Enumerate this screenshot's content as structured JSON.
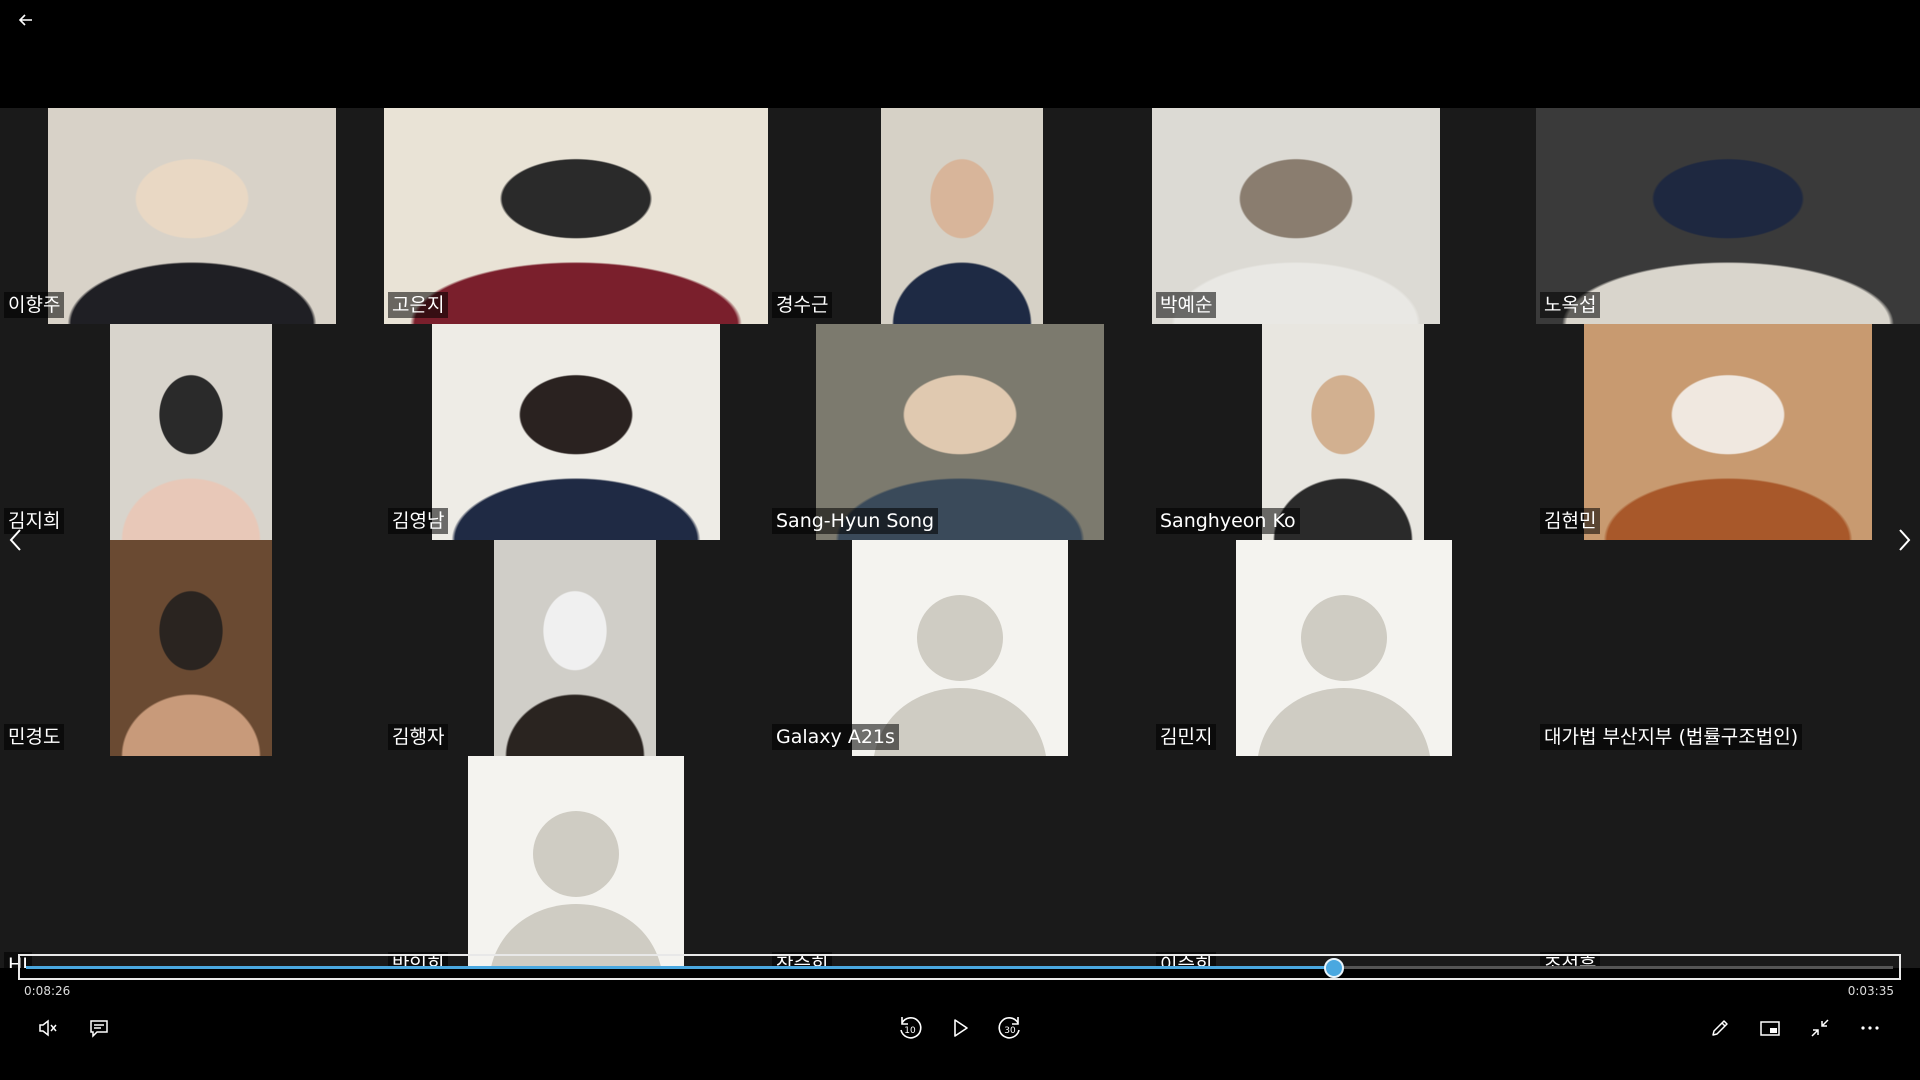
{
  "window": {
    "back_label": "Back"
  },
  "participants": [
    {
      "name": "이향주",
      "kind": "video",
      "colors": [
        "#d8d2c8",
        "#1f1f24",
        "#e9d8c4"
      ]
    },
    {
      "name": "고은지",
      "kind": "video",
      "colors": [
        "#e9e3d6",
        "#7a1f2c",
        "#2a2a2a"
      ]
    },
    {
      "name": "경수근",
      "kind": "video",
      "colors": [
        "#d6d1c6",
        "#1e2a44",
        "#d8b59a"
      ]
    },
    {
      "name": "박예순",
      "kind": "video",
      "colors": [
        "#dcdad4",
        "#e9e8e4",
        "#8a7d6f"
      ]
    },
    {
      "name": "노옥섭",
      "kind": "video",
      "colors": [
        "#3a3a3a",
        "#d9d5cc",
        "#1e2840"
      ]
    },
    {
      "name": "김지희",
      "kind": "video",
      "colors": [
        "#d8d4cc",
        "#e8c8b8",
        "#2a2a2a"
      ]
    },
    {
      "name": "김영남",
      "kind": "video",
      "colors": [
        "#eeece6",
        "#1f2a44",
        "#2a2220"
      ]
    },
    {
      "name": "Sang-Hyun Song",
      "kind": "video",
      "colors": [
        "#7c7a6e",
        "#3a4a5a",
        "#e0c9b0"
      ]
    },
    {
      "name": "Sanghyeon Ko",
      "kind": "video",
      "colors": [
        "#e8e6e0",
        "#2a2a2a",
        "#d2b090"
      ]
    },
    {
      "name": "김현민",
      "kind": "video",
      "colors": [
        "#c89a70",
        "#a8582a",
        "#f0e8e0"
      ]
    },
    {
      "name": "민경도",
      "kind": "video",
      "colors": [
        "#6a4a32",
        "#c89a7a",
        "#2a2420"
      ]
    },
    {
      "name": "김행자",
      "kind": "video",
      "colors": [
        "#d0cec8",
        "#2a2420",
        "#f0f0f0"
      ]
    },
    {
      "name": "Galaxy A21s",
      "kind": "placeholder"
    },
    {
      "name": "김민지",
      "kind": "placeholder"
    },
    {
      "name": "대가법 부산지부 (법률구조법인)",
      "kind": "none"
    },
    {
      "name": "HJ",
      "kind": "none",
      "clipped": true
    },
    {
      "name": "박인희",
      "kind": "placeholder",
      "clipped": true
    },
    {
      "name": "장승희",
      "kind": "none",
      "clipped": true
    },
    {
      "name": "이승희",
      "kind": "none",
      "clipped": true
    },
    {
      "name": "조성훈",
      "kind": "none",
      "clipped": true
    }
  ],
  "player": {
    "elapsed": "0:08:26",
    "remaining": "0:03:35",
    "progress": 0.7,
    "accent_color": "#4aa8e0",
    "controls": {
      "mute_icon": "volume-mute-icon",
      "subtitles_icon": "subtitles-icon",
      "skip_back_seconds": "10",
      "play_icon": "play-icon",
      "skip_forward_seconds": "30",
      "edit_icon": "pen-icon",
      "miniview_icon": "mini-view-icon",
      "exit_fullscreen_icon": "exit-fullscreen-icon",
      "more_icon": "more-icon"
    }
  }
}
